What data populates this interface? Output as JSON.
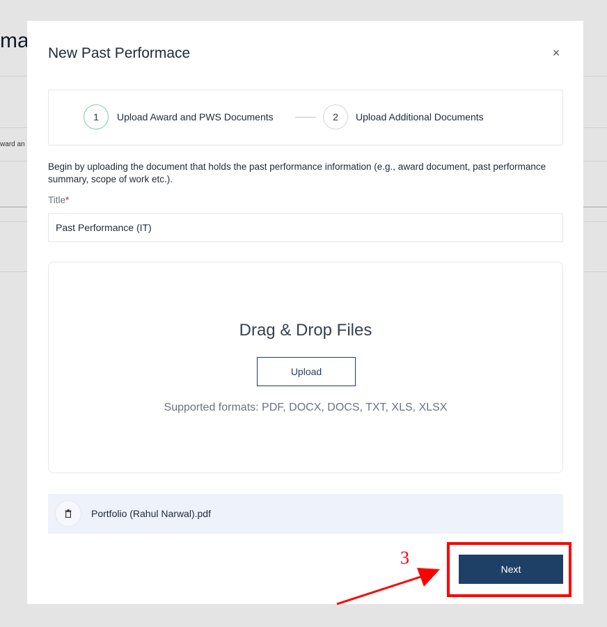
{
  "background": {
    "heading_fragment": "ma",
    "text_fragment": "ward an"
  },
  "modal": {
    "title": "New Past Performace",
    "close_glyph": "×",
    "stepper": {
      "steps": [
        {
          "number": "1",
          "label": "Upload Award and PWS Documents"
        },
        {
          "number": "2",
          "label": "Upload Additional Documents"
        }
      ]
    },
    "intro": "Begin by uploading the document that holds the past performance information (e.g., award document, past performance summary, scope of work etc.).",
    "title_field": {
      "label": "Title",
      "required_mark": "*",
      "value": "Past Performance (IT)"
    },
    "dropzone": {
      "heading": "Drag & Drop Files",
      "upload_label": "Upload",
      "formats": "Supported formats: PDF, DOCX, DOCS, TXT, XLS, XLSX"
    },
    "file": {
      "name": "Portfolio (Rahul Narwal).pdf",
      "icon": "trash-icon"
    },
    "next_label": "Next"
  },
  "annotation": {
    "step_number": "3",
    "color": "#ff0000"
  }
}
